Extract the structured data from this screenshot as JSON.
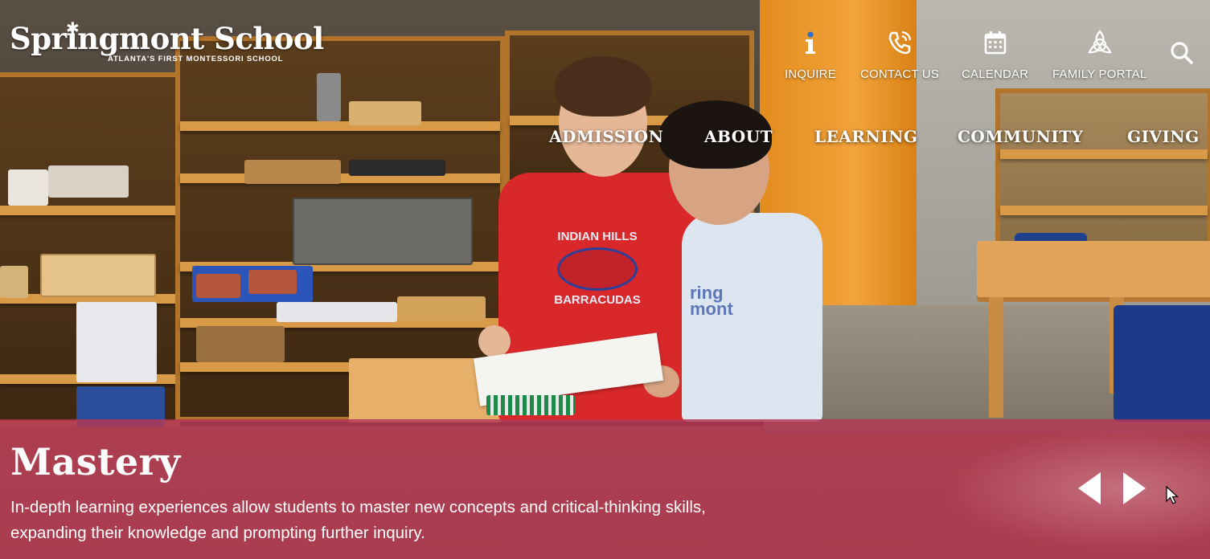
{
  "logo": {
    "name": "Springmont School",
    "tagline": "ATLANTA'S FIRST MONTESSORI SCHOOL"
  },
  "utility_nav": [
    {
      "label": "INQUIRE",
      "icon": "info-icon"
    },
    {
      "label": "CONTACT US",
      "icon": "phone-icon"
    },
    {
      "label": "CALENDAR",
      "icon": "calendar-icon"
    },
    {
      "label": "FAMILY PORTAL",
      "icon": "trinity-knot-icon"
    }
  ],
  "search": {
    "icon": "search-icon"
  },
  "main_nav": [
    "ADMISSION",
    "ABOUT",
    "LEARNING",
    "COMMUNITY",
    "GIVING"
  ],
  "hero": {
    "shirt_text_red": [
      "INDIAN HILLS",
      "BARRACUDAS"
    ],
    "shirt_text_white": [
      "ring",
      "mont"
    ]
  },
  "slide": {
    "title": "Mastery",
    "description_line1": "In-depth learning experiences allow students to master new concepts and critical-thinking skills,",
    "description_line2": "expanding their knowledge and prompting further inquiry."
  },
  "colors": {
    "band": "#b43755",
    "text": "#ffffff",
    "orange_wall": "#f2a33a"
  }
}
